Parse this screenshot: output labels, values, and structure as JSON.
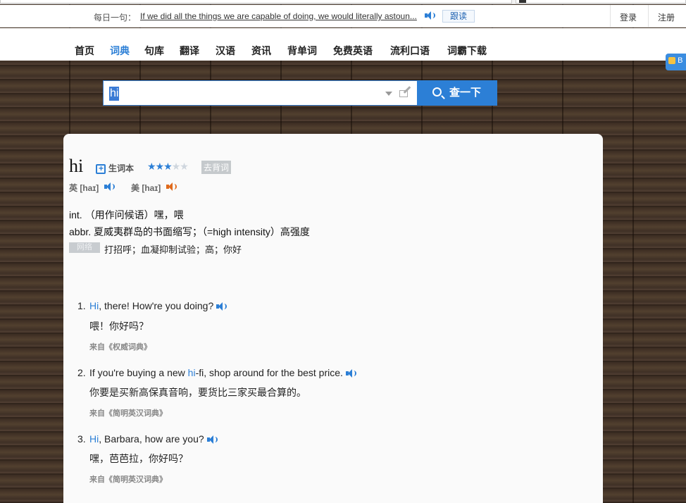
{
  "daily": {
    "label": "每日一句：",
    "sentence": "If we did all the things we are capable of doing, we would literally astoun...",
    "follow_read": "跟读"
  },
  "account": {
    "login": "登录",
    "register": "注册"
  },
  "nav": {
    "items": [
      {
        "label": "首页",
        "active": false
      },
      {
        "label": "词典",
        "active": true
      },
      {
        "label": "句库",
        "active": false
      },
      {
        "label": "翻译",
        "active": false
      },
      {
        "label": "汉语",
        "active": false
      },
      {
        "label": "资讯",
        "active": false
      },
      {
        "label": "背单词",
        "active": false
      },
      {
        "label": "免费英语",
        "active": false
      },
      {
        "label": "流利口语",
        "active": false
      },
      {
        "label": "词霸下载",
        "active": false
      }
    ]
  },
  "side_badge": "B",
  "search": {
    "value": "hi",
    "button_label": "查一下"
  },
  "entry": {
    "word": "hi",
    "wordbook_label": "生词本",
    "stars_filled": 3,
    "stars_total": 5,
    "level_tag": "去背词",
    "uk_phonetic": "英 [haɪ]",
    "us_phonetic": "美 [haɪ]",
    "definitions": [
      "int.  （用作问候语）嘿，喂",
      "abbr.  夏威夷群岛的书面缩写；（=high intensity）高强度"
    ],
    "net_tag": "网络",
    "net_definition": "打招呼；血凝抑制试验；高；你好"
  },
  "examples": [
    {
      "num": "1.",
      "en_before": "",
      "en_highlight": "Hi",
      "en_after": ", there! How're you doing?",
      "cn": "喂！你好吗？",
      "source": "来自《权威词典》"
    },
    {
      "num": "2.",
      "en_before": "If you're buying a new ",
      "en_highlight": "hi",
      "en_after": "-fi, shop around for the best price.",
      "cn": "你要是买新高保真音响，要货比三家买最合算的。",
      "source": "来自《简明英汉词典》"
    },
    {
      "num": "3.",
      "en_before": "",
      "en_highlight": "Hi",
      "en_after": ", Barbara, how are you?",
      "cn": "嘿，芭芭拉，你好吗？",
      "source": "来自《简明英汉词典》"
    }
  ],
  "colors": {
    "accent": "#2c7fd6",
    "us_speaker": "#e06a1c"
  }
}
